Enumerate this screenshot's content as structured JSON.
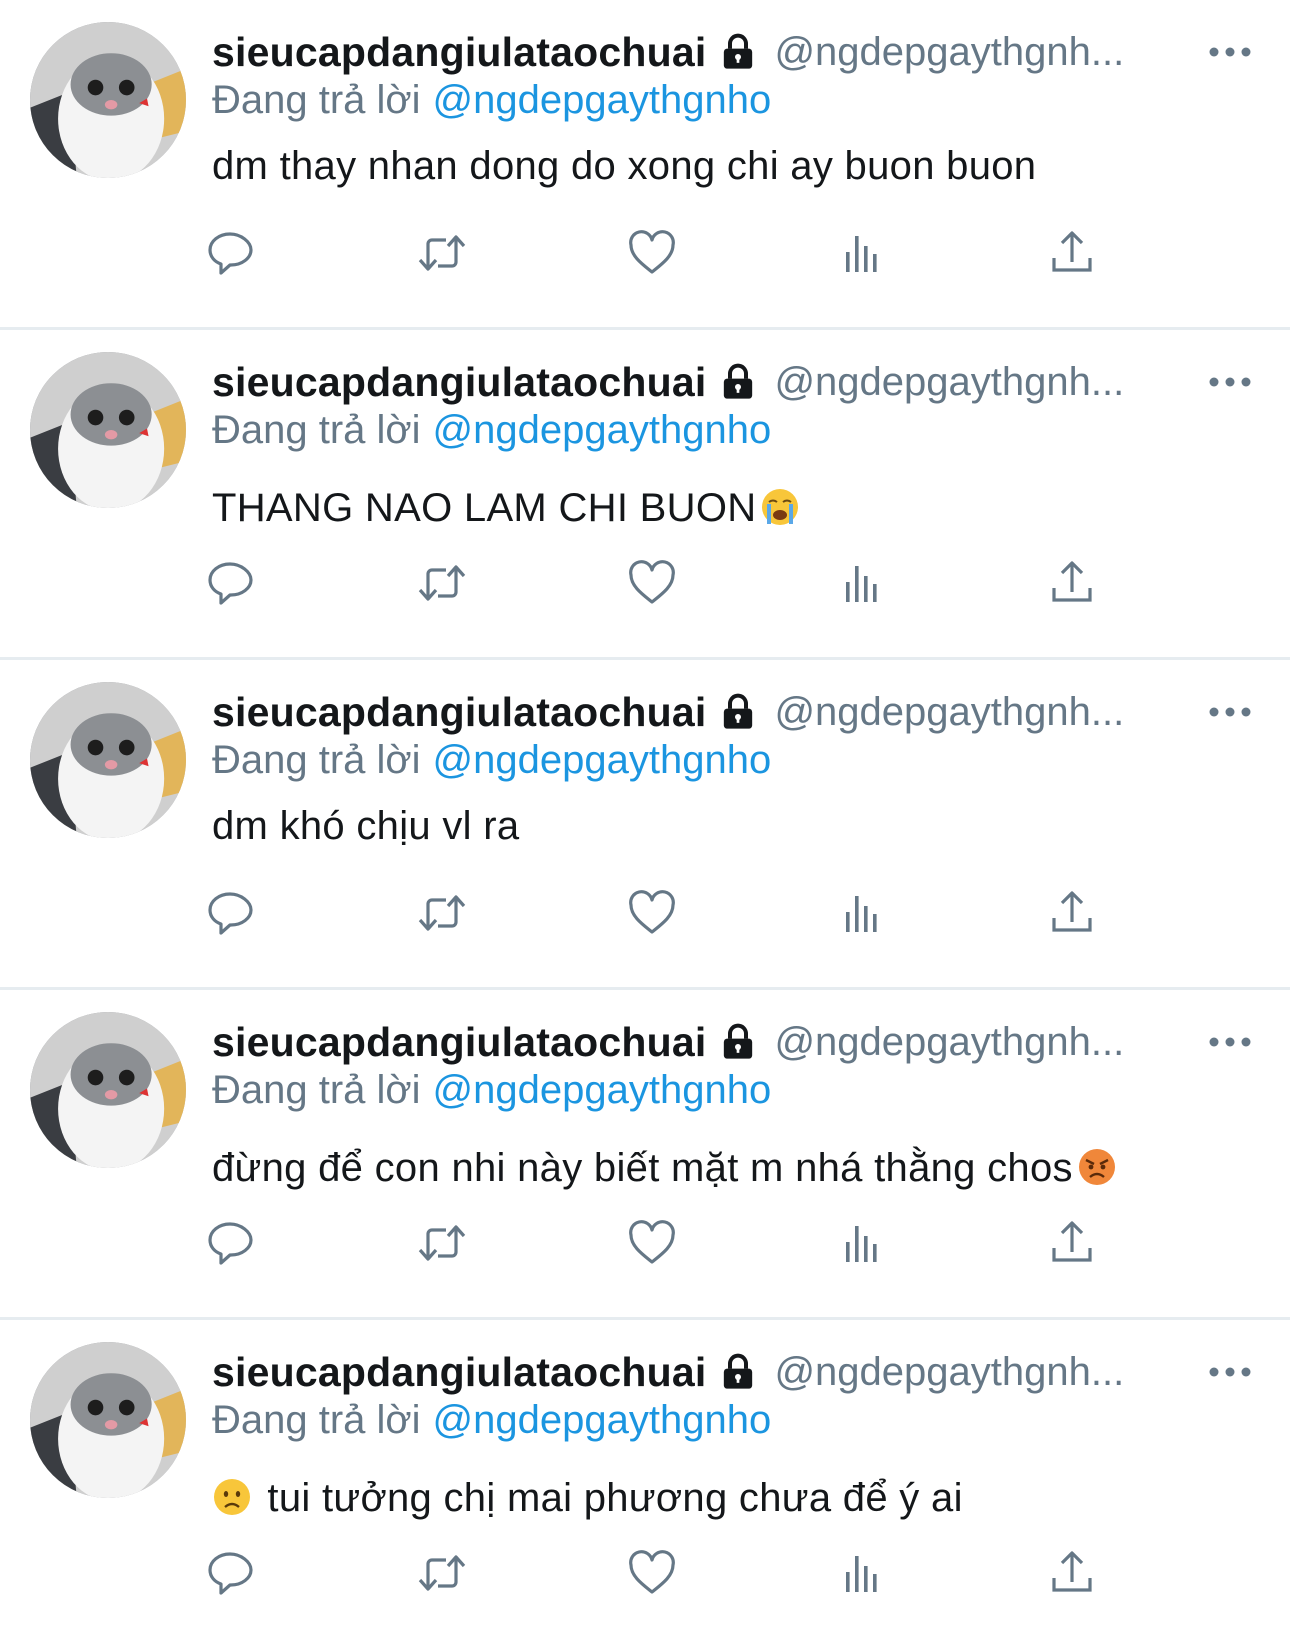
{
  "tweets": [
    {
      "display_name": "sieucapdangiulataochuai",
      "handle": "@ngdepgaythgnh...",
      "reply_prefix": "Đang trả lời",
      "reply_to": "@ngdepgaythgnho",
      "text": "dm thay nhan dong do xong chi ay buon buon",
      "emoji_before": "",
      "emoji_after": ""
    },
    {
      "display_name": "sieucapdangiulataochuai",
      "handle": "@ngdepgaythgnh...",
      "reply_prefix": "Đang trả lời",
      "reply_to": "@ngdepgaythgnho",
      "text": "THANG NAO LAM CHI BUON",
      "emoji_before": "",
      "emoji_after": "loudly-crying-face"
    },
    {
      "display_name": "sieucapdangiulataochuai",
      "handle": "@ngdepgaythgnh...",
      "reply_prefix": "Đang trả lời",
      "reply_to": "@ngdepgaythgnho",
      "text": "dm khó chịu vl ra",
      "emoji_before": "",
      "emoji_after": ""
    },
    {
      "display_name": "sieucapdangiulataochuai",
      "handle": "@ngdepgaythgnh...",
      "reply_prefix": "Đang trả lời",
      "reply_to": "@ngdepgaythgnho",
      "text": "đừng để con nhi này biết mặt m nhá thằng chos",
      "emoji_before": "",
      "emoji_after": "angry-face"
    },
    {
      "display_name": "sieucapdangiulataochuai",
      "handle": "@ngdepgaythgnh...",
      "reply_prefix": "Đang trả lời",
      "reply_to": "@ngdepgaythgnho",
      "text": " tui tưởng chị mai phương chưa để ý ai",
      "emoji_before": "slightly-frowning-face",
      "emoji_after": ""
    }
  ],
  "icons": {
    "reply": "reply-icon",
    "retweet": "retweet-icon",
    "like": "like-icon",
    "stats": "stats-icon",
    "share": "share-icon",
    "more": "more-icon",
    "lock": "lock-icon"
  },
  "colors": {
    "name": "#14171a",
    "secondary": "#657786",
    "link": "#1b95e0",
    "divider": "#e6ecf0",
    "icon": "#657786"
  }
}
